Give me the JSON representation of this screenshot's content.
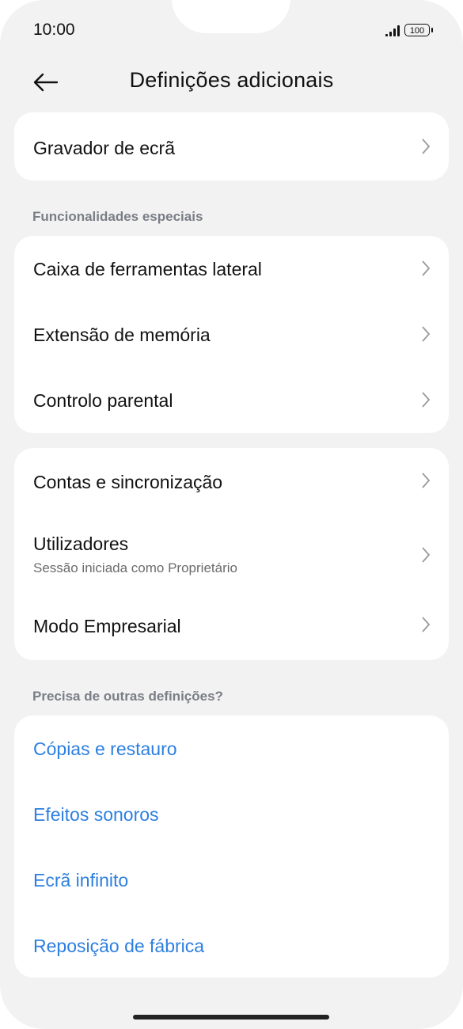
{
  "status_bar": {
    "time": "10:00",
    "battery": "100"
  },
  "header": {
    "title": "Definições adicionais"
  },
  "card1": {
    "items": [
      {
        "label": "Gravador de ecrã"
      }
    ]
  },
  "section_special": {
    "title": "Funcionalidades especiais"
  },
  "card2": {
    "items": [
      {
        "label": "Caixa de ferramentas lateral"
      },
      {
        "label": "Extensão de memória"
      },
      {
        "label": "Controlo parental"
      }
    ]
  },
  "card3": {
    "items": [
      {
        "label": "Contas e sincronização"
      },
      {
        "label": "Utilizadores",
        "sublabel": "Sessão iniciada como Proprietário"
      },
      {
        "label": "Modo Empresarial"
      }
    ]
  },
  "section_more": {
    "title": "Precisa de outras definições?"
  },
  "links": [
    {
      "label": "Cópias e restauro"
    },
    {
      "label": "Efeitos sonoros"
    },
    {
      "label": "Ecrã infinito"
    },
    {
      "label": "Reposição de fábrica"
    }
  ],
  "colors": {
    "link": "#2d7fe0",
    "background": "#f2f2f2",
    "card": "#ffffff"
  }
}
